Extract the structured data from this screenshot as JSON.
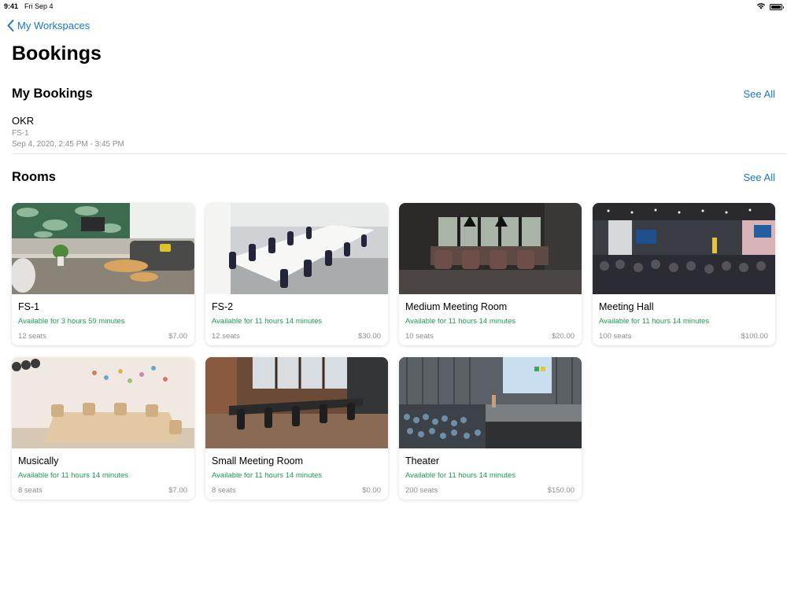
{
  "status_bar": {
    "time": "9:41",
    "date": "Fri Sep 4",
    "icons": [
      "wifi-icon",
      "battery-icon"
    ]
  },
  "nav": {
    "back_label": "My Workspaces",
    "back_icon": "chevron-left-icon"
  },
  "page": {
    "title": "Bookings"
  },
  "my_bookings": {
    "title": "My Bookings",
    "see_all_label": "See All",
    "items": [
      {
        "name": "OKR",
        "room": "FS-1",
        "time": "Sep 4, 2020, 2:45 PM - 3:45 PM"
      }
    ]
  },
  "rooms": {
    "title": "Rooms",
    "see_all_label": "See All",
    "items": [
      {
        "name": "FS-1",
        "availability": "Available for 3 hours 59 minutes",
        "seats": "12 seats",
        "price": "$7.00"
      },
      {
        "name": "FS-2",
        "availability": "Available for 11 hours 14 minutes",
        "seats": "12 seats",
        "price": "$30.00"
      },
      {
        "name": "Medium Meeting Room",
        "availability": "Available for 11 hours 14 minutes",
        "seats": "10 seats",
        "price": "$20.00"
      },
      {
        "name": "Meeting Hall",
        "availability": "Available for 11 hours 14 minutes",
        "seats": "100 seats",
        "price": "$100.00"
      },
      {
        "name": "Musically",
        "availability": "Available for 11 hours 14 minutes",
        "seats": "8 seats",
        "price": "$7.00"
      },
      {
        "name": "Small Meeting Room",
        "availability": "Available for 11 hours 14 minutes",
        "seats": "8 seats",
        "price": "$0.00"
      },
      {
        "name": "Theater",
        "availability": "Available for 11 hours 14 minutes",
        "seats": "200 seats",
        "price": "$150.00"
      }
    ]
  },
  "colors": {
    "accent": "#1976d2",
    "available": "#1e9e4f",
    "secondary_text": "#8e8e93"
  }
}
